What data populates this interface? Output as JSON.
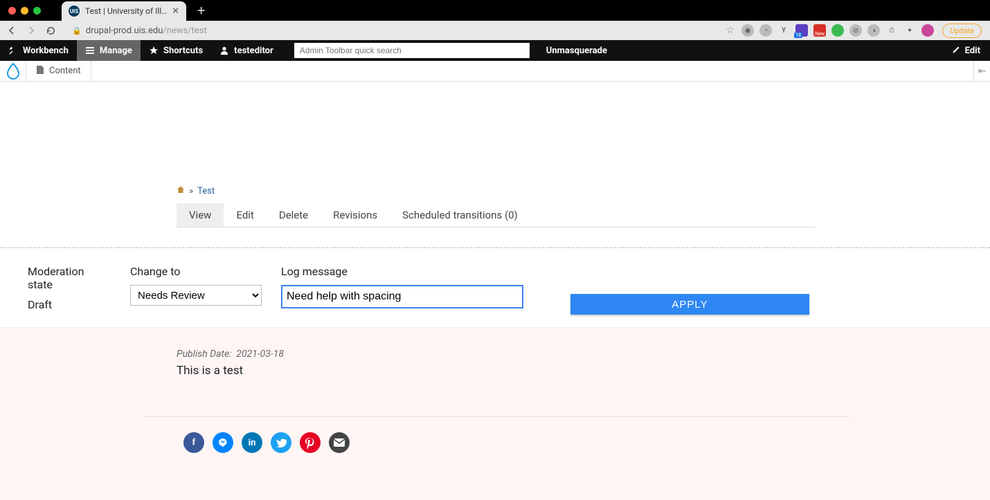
{
  "browser": {
    "tab_title": "Test | University of Illinois Spri",
    "url_host": "drupal-prod.uis.edu",
    "url_path": "/news/test",
    "update_label": "Update",
    "ext_badge_number": "18",
    "ext_badge2_label": "New"
  },
  "admin": {
    "workbench": "Workbench",
    "manage": "Manage",
    "shortcuts": "Shortcuts",
    "user": "testeditor",
    "search_placeholder": "Admin Toolbar quick search",
    "unmasquerade": "Unmasquerade",
    "edit": "Edit",
    "content": "Content"
  },
  "breadcrumb": {
    "separator": "»",
    "current": "Test"
  },
  "tabs": {
    "view": "View",
    "edit": "Edit",
    "delete": "Delete",
    "revisions": "Revisions",
    "scheduled": "Scheduled transitions (0)"
  },
  "moderation": {
    "state_label": "Moderation state",
    "state_value": "Draft",
    "change_to_label": "Change to",
    "select_value": "Needs Review",
    "log_label": "Log message",
    "log_value": "Need help with spacing",
    "apply": "APPLY"
  },
  "content": {
    "publish_date_label": "Publish Date:",
    "publish_date_value": "2021-03-18",
    "body": "This is a test"
  }
}
